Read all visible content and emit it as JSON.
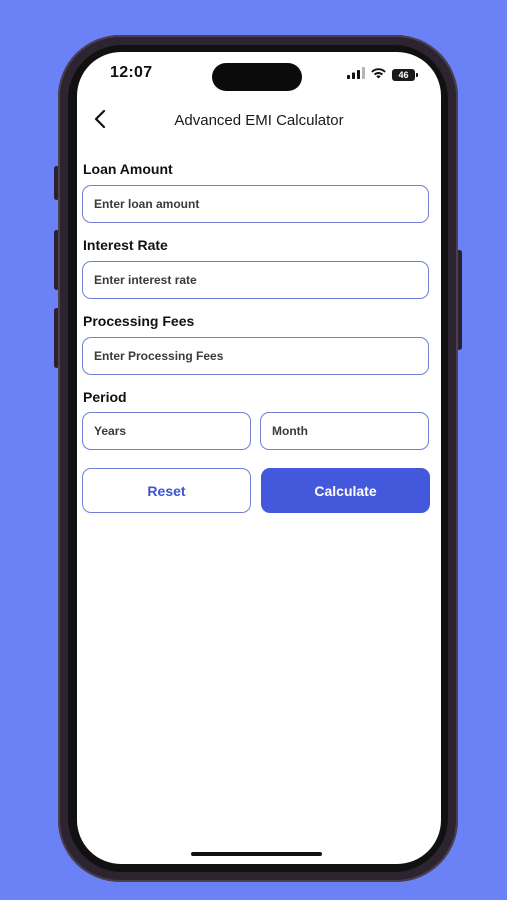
{
  "status_bar": {
    "time": "12:07",
    "battery": "46"
  },
  "nav": {
    "title": "Advanced EMI Calculator"
  },
  "form": {
    "loan_amount": {
      "label": "Loan Amount",
      "placeholder": "Enter loan amount",
      "value": ""
    },
    "interest_rate": {
      "label": "Interest Rate",
      "placeholder": "Enter interest rate",
      "value": ""
    },
    "processing_fees": {
      "label": "Processing Fees",
      "placeholder": "Enter Processing Fees",
      "value": ""
    },
    "period": {
      "label": "Period",
      "years_placeholder": "Years",
      "month_placeholder": "Month"
    }
  },
  "actions": {
    "reset_label": "Reset",
    "calculate_label": "Calculate"
  },
  "colors": {
    "background": "#6b82f6",
    "accent": "#4458dc",
    "input_border": "#6f7fd9"
  },
  "icons": {
    "back": "chevron-left-icon",
    "signal": "cellular-signal-icon",
    "wifi": "wifi-icon",
    "battery": "battery-icon"
  }
}
